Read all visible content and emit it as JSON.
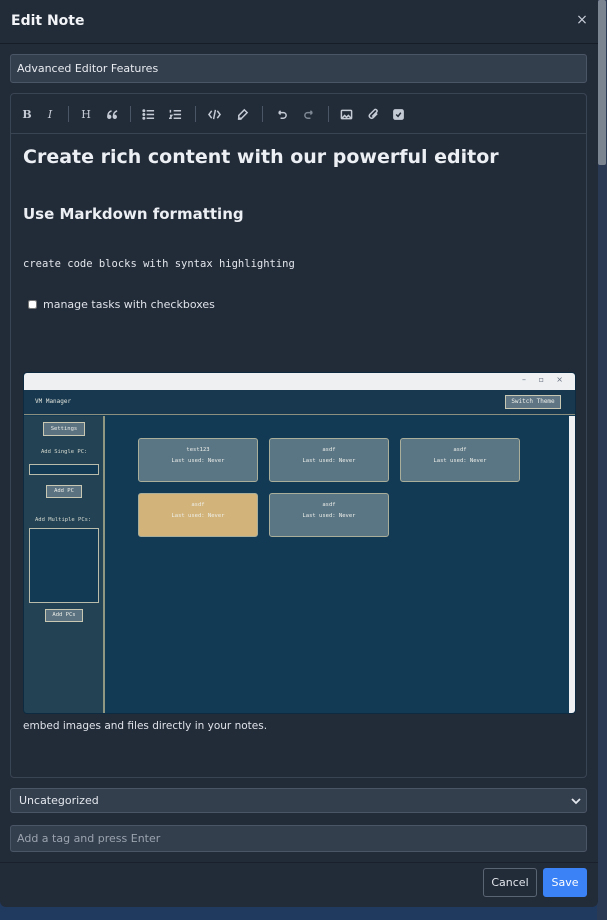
{
  "modal": {
    "title": "Edit Note",
    "close_symbol": "×"
  },
  "note": {
    "title_value": "Advanced Editor Features",
    "heading1": "Create rich content with our powerful editor",
    "heading2": "Use Markdown formatting",
    "code_line": "create code blocks with syntax highlighting",
    "task_label": "manage tasks with checkboxes",
    "task_checked": false,
    "caption": "embed images and files directly in your notes."
  },
  "toolbar": {
    "items": [
      "bold-icon",
      "italic-icon",
      "heading-icon",
      "quote-icon",
      "bullet-list-icon",
      "numbered-list-icon",
      "code-icon",
      "highlighter-icon",
      "undo-icon",
      "redo-icon",
      "image-icon",
      "attachment-icon",
      "checkbox-icon"
    ],
    "bold": "B",
    "italic": "I",
    "heading": "H"
  },
  "embedded_screenshot": {
    "window_controls": [
      "–",
      "▫",
      "×"
    ],
    "app_title": "VM Manager",
    "switch_theme": "Switch Theme",
    "settings": "Settings",
    "add_single_label": "Add Single PC:",
    "add_pc_button": "Add PC",
    "add_multiple_label": "Add Multiple PCs:",
    "add_pcs_button": "Add PCs",
    "cards": [
      {
        "name": "test123",
        "last_used": "Last used: Never",
        "highlight": false
      },
      {
        "name": "asdf",
        "last_used": "Last used: Never",
        "highlight": false
      },
      {
        "name": "asdf",
        "last_used": "Last used: Never",
        "highlight": false
      },
      {
        "name": "asdf",
        "last_used": "Last used: Never",
        "highlight": true
      },
      {
        "name": "asdf",
        "last_used": "Last used: Never",
        "highlight": false
      }
    ]
  },
  "category": {
    "selected": "Uncategorized"
  },
  "tags": {
    "placeholder": "Add a tag and press Enter"
  },
  "actions": {
    "cancel": "Cancel",
    "save": "Save"
  },
  "colors": {
    "modal_bg": "#222b38",
    "input_bg": "#343f4e",
    "accent": "#3b82f6",
    "backdrop": "#20395f"
  }
}
